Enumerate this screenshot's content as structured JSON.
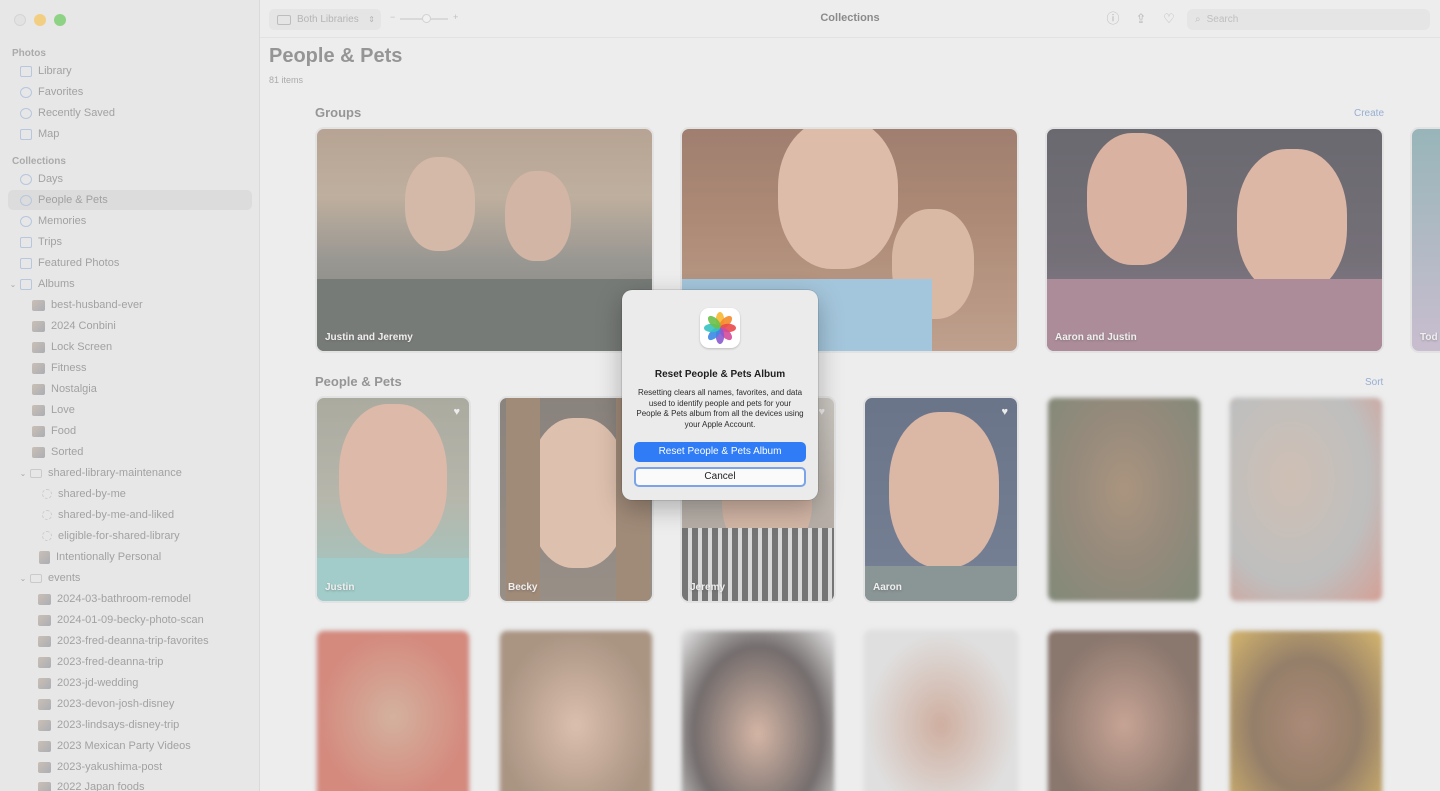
{
  "toolbar": {
    "library_select": "Both Libraries",
    "zoom_minus": "−",
    "zoom_plus": "+",
    "title": "Collections",
    "search_placeholder": "Search"
  },
  "sidebar": {
    "photos_header": "Photos",
    "photos_items": [
      "Library",
      "Favorites",
      "Recently Saved",
      "Map"
    ],
    "collections_header": "Collections",
    "collections_items": [
      "Days",
      "People & Pets",
      "Memories",
      "Trips",
      "Featured Photos"
    ],
    "albums_label": "Albums",
    "albums_items": [
      "best-husband-ever",
      "2024 Conbini",
      "Lock Screen",
      "Fitness",
      "Nostalgia",
      "Love",
      "Food",
      "Sorted"
    ],
    "folder_shared": "shared-library-maintenance",
    "shared_items": [
      "shared-by-me",
      "shared-by-me-and-liked",
      "eligible-for-shared-library"
    ],
    "intentional": "Intentionally Personal",
    "folder_events": "events",
    "event_items": [
      "2024-03-bathroom-remodel",
      "2024-01-09-becky-photo-scan",
      "2023-fred-deanna-trip-favorites",
      "2023-fred-deanna-trip",
      "2023-jd-wedding",
      "2023-devon-josh-disney",
      "2023-lindsays-disney-trip",
      "2023 Mexican Party Videos",
      "2023-yakushima-post",
      "2022 Japan foods"
    ]
  },
  "main": {
    "title": "People & Pets",
    "count": "81 items",
    "groups_header": "Groups",
    "groups_action": "Create",
    "groups": [
      "Justin and Jeremy",
      "",
      "Aaron and Justin",
      "Tod"
    ],
    "people_header": "People & Pets",
    "people_action": "Sort",
    "people": [
      "Justin",
      "Becky",
      "Jeremy",
      "Aaron"
    ]
  },
  "dialog": {
    "title": "Reset People & Pets Album",
    "message": "Resetting clears all names, favorites, and data used to identify people and pets for your People & Pets album from all the devices using your Apple Account.",
    "primary_button": "Reset People & Pets Album",
    "cancel_button": "Cancel"
  },
  "colors": {
    "accent": "#2f7cf6",
    "link": "#6f8fc6"
  }
}
